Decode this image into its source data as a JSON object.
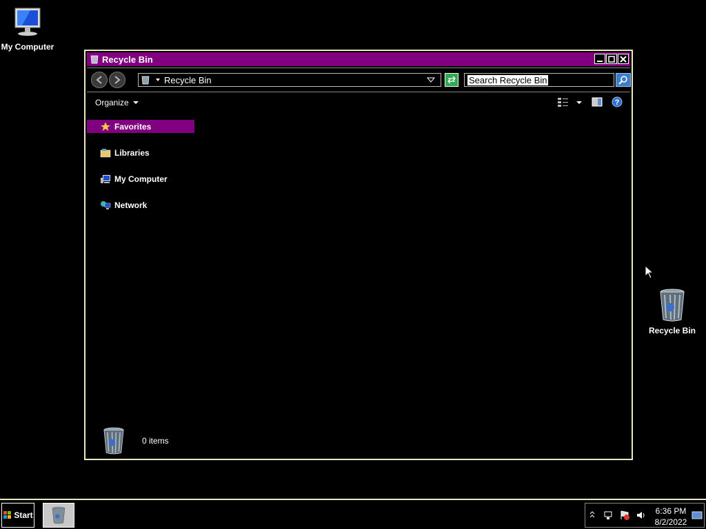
{
  "desktop": {
    "icons": [
      {
        "label": "My Computer",
        "icon": "my-computer-icon"
      },
      {
        "label": "Recycle Bin",
        "icon": "recycle-bin-icon"
      }
    ]
  },
  "window": {
    "title": "Recycle Bin",
    "address_path": "Recycle Bin",
    "search_placeholder": "Search Recycle Bin",
    "toolbar": {
      "organize_label": "Organize"
    },
    "nav_items": [
      {
        "label": "Favorites",
        "icon": "star-icon",
        "selected": true
      },
      {
        "label": "Libraries",
        "icon": "libraries-icon"
      },
      {
        "label": "My Computer",
        "icon": "computer-icon"
      },
      {
        "label": "Network",
        "icon": "network-icon"
      }
    ],
    "status": {
      "item_count": "0 items"
    }
  },
  "taskbar": {
    "start_label": "Start",
    "clock": {
      "time": "6:36 PM",
      "date": "8/2/2022"
    }
  },
  "colors": {
    "title_bar": "#800080",
    "selection": "#800080",
    "window_border": "#ecebc4",
    "background": "#000000"
  }
}
